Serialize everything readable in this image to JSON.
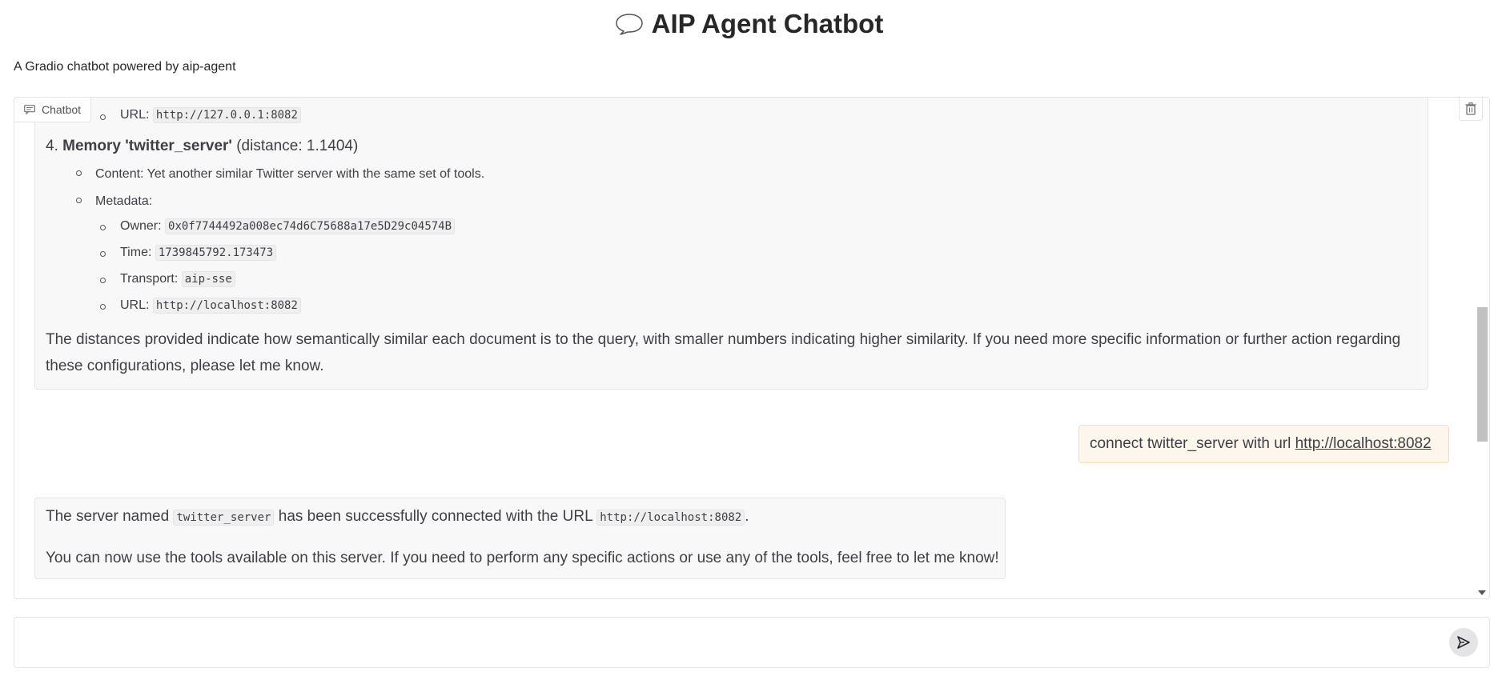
{
  "header": {
    "title": "AIP Agent Chatbot",
    "title_icon": "speech-bubble-icon",
    "subtitle": "A Gradio chatbot powered by aip-agent"
  },
  "chatbot": {
    "label": "Chatbot",
    "label_icon": "chat-icon",
    "clear_icon": "trash-icon"
  },
  "messages": {
    "bot1": {
      "top_url_label": "URL:",
      "top_url_value": "http://127.0.0.1:8082",
      "item4": {
        "number": "4.",
        "name": "Memory 'twitter_server'",
        "distance": "(distance: 1.1404)",
        "content": "Content: Yet another similar Twitter server with the same set of tools.",
        "metadata_label": "Metadata:",
        "owner_label": "Owner:",
        "owner_value": "0x0f7744492a008ec74d6C75688a17e5D29c04574B",
        "time_label": "Time:",
        "time_value": "1739845792.173473",
        "transport_label": "Transport:",
        "transport_value": "aip-sse",
        "url_label": "URL:",
        "url_value": "http://localhost:8082"
      },
      "closing": "The distances provided indicate how semantically similar each document is to the query, with smaller numbers indicating higher similarity. If you need more specific information or further action regarding these configurations, please let me know."
    },
    "user1": {
      "text": "connect twitter_server with url ",
      "link": "http://localhost:8082"
    },
    "bot2": {
      "line1_a": "The server named ",
      "line1_code1": "twitter_server",
      "line1_b": " has been successfully connected with the URL ",
      "line1_code2": "http://localhost:8082",
      "line1_c": ".",
      "line2": "You can now use the tools available on this server. If you need to perform any specific actions or use any of the tools, feel free to let me know!"
    }
  },
  "input": {
    "value": "",
    "placeholder": "",
    "send_icon": "send-icon"
  }
}
